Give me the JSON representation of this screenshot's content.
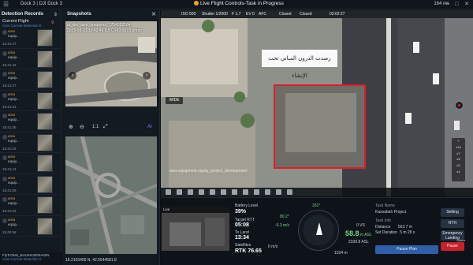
{
  "app": {
    "title": "Dock 3 | DJI Dock 3",
    "center_status": "Live Flight Controls-Task in Progress",
    "connection": "164 ms"
  },
  "left_panel": {
    "header": "Detection Records",
    "current_flight_label": "Current Flight",
    "current_flight_count": "9",
    "sub_label": "Auto Current Detection II",
    "records": [
      {
        "title": "area",
        "subtitle": "equip...",
        "time": "15:41:47"
      },
      {
        "title": "area",
        "subtitle": "equip...",
        "time": "15:41:42"
      },
      {
        "title": "area",
        "subtitle": "equip...",
        "time": "15:41:37"
      },
      {
        "title": "area",
        "subtitle": "equip...",
        "time": "15:41:31"
      },
      {
        "title": "area",
        "subtitle": "equip...",
        "time": "15:41:26"
      },
      {
        "title": "area",
        "subtitle": "equip...",
        "time": "15:41:19"
      },
      {
        "title": "area",
        "subtitle": "equip...",
        "time": "15:41:14"
      },
      {
        "title": "area",
        "subtitle": "equip...",
        "time": "15:41:09"
      },
      {
        "title": "area",
        "subtitle": "equip...",
        "time": "15:41:04"
      },
      {
        "title": "area",
        "subtitle": "equip...",
        "time": "15:40:58"
      }
    ],
    "footer_line1": "FlyToTask_BUUKN3000A63N",
    "footer_line2": "Auto Current Detection II"
  },
  "snapshot": {
    "header": "Snapshots",
    "caption_line1": "ai_vlm_alert_snapshot_1754052164",
    "caption_line2": "2025-08-01 15:42:46 (UTC+03:00) 6 photo",
    "zoom_label": "1:1",
    "ai_label": "AI",
    "coordinates": "18.2103406 N, 42.5544581 E"
  },
  "main_view": {
    "status_items": [
      "ISO 500",
      "Shutter 1/2000",
      "F 1.7",
      "EV 0",
      "AFC",
      "Closed",
      "Closed",
      "03:02:27"
    ],
    "caption_arabic": "رصدت الدرون المباني تحت الإنشاء",
    "wide_label": "WIDE",
    "watermark": "area equipment equity_project_development"
  },
  "bottom": {
    "view_label": "Live",
    "battery_label": "Battery Level",
    "battery_value": "39%",
    "speed_label": "Target RTT",
    "speed_value": "05:08",
    "distance_label": "To Land",
    "distance_value": "13:34",
    "satellite_label": "Satellites",
    "satellite_value": "RTK 76.65",
    "heading": "331°",
    "wind_value": "-6.3 m/s",
    "alt_vs": "0 VS",
    "alt_value": "58.8",
    "alt_unit": "m ASL",
    "alt_asl": "2339.8 ASL",
    "speed_hs": "0 m/s",
    "bottom_dist": "1034 m",
    "pitch": "80.2°",
    "task_name_label": "Task Name",
    "task_name": "Kassabah Project",
    "task_info_label": "Task Info",
    "distance_info_label": "Distance",
    "distance_info": "563.7 m",
    "set_duration_label": "Set Duration",
    "set_duration": "5 m 28 s",
    "pause_plan": "Pause Plan",
    "settings": "Setting",
    "rth": "RTH",
    "emergency": "Emergency Landing",
    "pause": "Pause",
    "space_hint": "Space"
  },
  "right_controls": [
    "+",
    "x14",
    "x7",
    "x3",
    "x2",
    "x1",
    "-"
  ]
}
